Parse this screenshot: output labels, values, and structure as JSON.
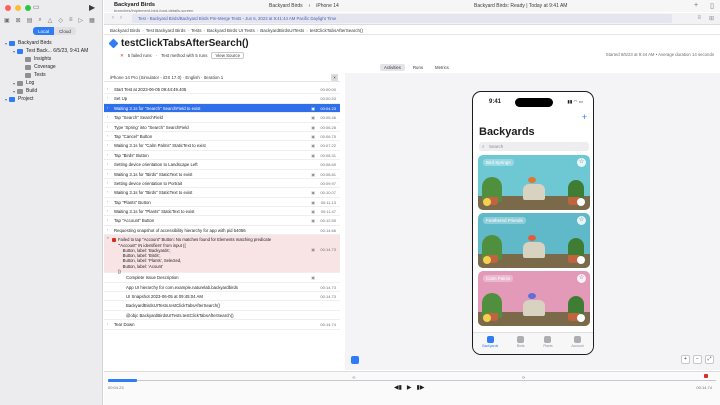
{
  "sidebar": {
    "segments": [
      "Local",
      "Cloud"
    ],
    "active_segment": "Local",
    "tree": [
      {
        "label": "Backyard Birds",
        "icon_color": "#2f7cf6",
        "indent": 0
      },
      {
        "label": "Test Back... 6/5/23, 9:41 AM",
        "icon_color": "#2f7cf6",
        "indent": 1
      },
      {
        "label": "Insights",
        "icon_color": "#8e8e93",
        "indent": 2
      },
      {
        "label": "Coverage",
        "icon_color": "#8e8e93",
        "indent": 2
      },
      {
        "label": "Tests",
        "icon_color": "#8e8e93",
        "indent": 2
      },
      {
        "label": "Log",
        "icon_color": "#8e8e93",
        "indent": 1
      },
      {
        "label": "Build",
        "icon_color": "#8e8e93",
        "indent": 1
      },
      {
        "label": "Project",
        "icon_color": "#2f7cf6",
        "indent": 0
      }
    ]
  },
  "toolbar": {
    "project_title": "Backyard Birds",
    "branch": "branches/implement-bird-food-details-screen",
    "scheme": "Backyard Birds",
    "device": "iPhone 14",
    "status": "Backyard Birds: Ready | Today at 9:41 AM"
  },
  "tab": {
    "label": "Test - Backyard Birds/Backyard Birds Pre-Merge Tests - Jun 5, 2023 at 9:41:44 AM Pacific Daylight Time"
  },
  "breadcrumb": [
    "Backyard Birds",
    "Test Backyard Birds",
    "Tests",
    "Backyard Birds UI Tests",
    "BackyardBirdsUITests",
    "testClickTabsAfterSearch()"
  ],
  "test": {
    "title": "testClickTabsAfterSearch()",
    "failed_runs": "5 failed runs",
    "methods": "Test method with 5 runs",
    "view_source": "View Source",
    "started": "Started 6/5/23 at 9:44 AM • Average duration 14 seconds",
    "subtabs": [
      "Activities",
      "Runs",
      "Metrics"
    ],
    "active_subtab": "Activities"
  },
  "list_header": "iPhone 14 Pro (Simulator - iOS 17.0) · English · Iteration 1",
  "activities_top": [
    {
      "label": "Start Test at 2023-06-05 09:44:49.405",
      "time": "00:00:00",
      "shot": false,
      "sel": false,
      "indent": 0
    },
    {
      "label": "Set Up",
      "time": "00:00.53",
      "shot": false,
      "sel": false,
      "indent": 0
    },
    {
      "label": "Waiting 3.1s for \"Search\" SearchField to exist",
      "time": "00:04.23",
      "shot": true,
      "sel": true,
      "indent": 0
    },
    {
      "label": "Tap \"Search\" SearchField",
      "time": "00:05.46",
      "shot": true,
      "sel": false,
      "indent": 0
    },
    {
      "label": "Type 'Spring' into \"Search\" SearchField",
      "time": "00:06.28",
      "shot": true,
      "sel": false,
      "indent": 0
    },
    {
      "label": "Tap \"Cancel\" Button",
      "time": "00:06.75",
      "shot": true,
      "sel": false,
      "indent": 0
    },
    {
      "label": "Waiting 3.1s for \"Calm Palms\" StaticText to exist",
      "time": "00:07.22",
      "shot": true,
      "sel": false,
      "indent": 0
    },
    {
      "label": "Tap \"Birds\" Button",
      "time": "00:08.31",
      "shot": true,
      "sel": false,
      "indent": 0
    },
    {
      "label": "Setting device orientation to Landscape Left",
      "time": "00:08.69",
      "shot": false,
      "sel": false,
      "indent": 0
    },
    {
      "label": "Waiting 3.1s for \"Birds\" StaticText to exist",
      "time": "00:08.81",
      "shot": true,
      "sel": false,
      "indent": 0
    },
    {
      "label": "Setting device orientation to Portrait",
      "time": "00:09.97",
      "shot": false,
      "sel": false,
      "indent": 0
    },
    {
      "label": "Waiting 3.1s for \"Birds\" StaticText to exist",
      "time": "00:10.07",
      "shot": true,
      "sel": false,
      "indent": 0
    },
    {
      "label": "Tap \"Plants\" Button",
      "time": "00:11.13",
      "shot": true,
      "sel": false,
      "indent": 0
    },
    {
      "label": "Waiting 3.1s for \"Plants\" StaticText to exist",
      "time": "00:11.47",
      "shot": true,
      "sel": false,
      "indent": 0
    },
    {
      "label": "Tap \"Account\" Button",
      "time": "00:12.55",
      "shot": true,
      "sel": false,
      "indent": 0
    },
    {
      "label": "Requesting snapshot of accessibility hierarchy for app with pid 54056",
      "time": "00:14.66",
      "shot": false,
      "sel": false,
      "indent": 0
    }
  ],
  "failure": {
    "lines": [
      "Failed to tap \"Account\" Button: No matches found for Elements matching predicate",
      "'\"Account\" IN identifiers' from input {(",
      "    Button, label: 'Backyards',",
      "    Button, label: 'Birds',",
      "    Button, label: 'Plants', Selected,",
      "    Button, label: 'Acount'",
      ")}"
    ],
    "time": "00:14.73"
  },
  "activities_bottom": [
    {
      "label": "Complete Issue Description",
      "time": "",
      "shot": true,
      "sel": false,
      "indent": 1
    },
    {
      "label": "App UI hierarchy for com.example.naturelab.backyardbirds",
      "time": "00:14.73",
      "shot": false,
      "sel": false,
      "indent": 1
    },
    {
      "label": "UI Snapshot 2023-06-05 at 09:45:04 AM",
      "time": "00:14.73",
      "shot": false,
      "sel": false,
      "indent": 1
    },
    {
      "label": "BackyardBirdsUITests.testClickTabsAfterSearch()",
      "time": "",
      "shot": false,
      "sel": false,
      "indent": 1
    },
    {
      "label": "@objc BackyardBirdsUITests.testClickTabsAfterSearch()",
      "time": "",
      "shot": false,
      "sel": false,
      "indent": 1
    },
    {
      "label": "Tear Down",
      "time": "00:14.74",
      "shot": false,
      "sel": false,
      "indent": 0
    }
  ],
  "phone": {
    "time": "9:41",
    "title": "Backyards",
    "search_placeholder": "Search",
    "cards": [
      {
        "name": "Bird Springs",
        "bg": "#6ec8d4",
        "bird": "#e0762f"
      },
      {
        "name": "Feathered Friends",
        "bg": "#5fb9c9",
        "bird": "#e45b3a"
      },
      {
        "name": "Calm Palms",
        "bg": "#e39ab9",
        "bird": "#5e6fd6"
      }
    ],
    "tabs": [
      "Backyards",
      "Birds",
      "Plants",
      "Account"
    ],
    "active_tab": "Backyards"
  },
  "timeline": {
    "current": "00:04.23",
    "end": "00:14.74",
    "progress": 0.29
  },
  "colors": {
    "accent": "#2f7cf6",
    "error": "#d62d20",
    "selection": "#2f6fea"
  }
}
